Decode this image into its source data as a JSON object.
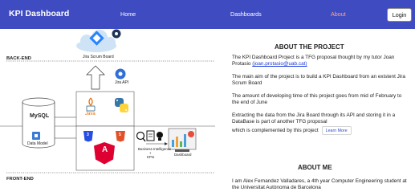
{
  "navbar": {
    "brand": "KPI Dashboard",
    "links": [
      {
        "label": "Home",
        "active": false
      },
      {
        "label": "Dashboards",
        "active": false
      },
      {
        "label": "About",
        "active": true
      }
    ],
    "login_label": "Login"
  },
  "colors": {
    "navbar_bg": "#3f4bc0",
    "active_link": "#f7a98a",
    "link_blue": "#1a3bd8"
  },
  "diagram": {
    "backend_label": "BACK-END",
    "frontend_label": "FRONT-END",
    "jira_board_label": "Jira Scrum Board",
    "jira_api_label": "Jira API",
    "data_model_label": "Data Model",
    "bi_label_line1": "Business Intelligence",
    "bi_label_line2": "+",
    "bi_label_line3": "KPIs",
    "dashboard_label": "Dashboard",
    "mysql_label": "MySQL",
    "java_label": "Java",
    "angular_letter": "A",
    "css_badge": "3",
    "html_badge": "5"
  },
  "about_project": {
    "title": "ABOUT THE PROJECT",
    "p1_text": "The KPI Dashboard Project is a TFG proposal thought by my tutor Joan Protasio ",
    "p1_link": "(joan.protasio@uab.cat)",
    "p2": "The main aim of the project is to build a KPI Dashboard from an existent Jira Scrum Board",
    "p3": "The amount of developing time of this project goes from mid of February to the end of June",
    "p4_line1": "Extracting the data from the Jira Board through its API and storing it in a DataBase is part of another TFG proposal",
    "p4_line2": "which is complemented by this project",
    "learn_more": "Learn More"
  },
  "about_me": {
    "title": "ABOUT ME",
    "p1": "I am Alex Fernandez Valladares, a 4th year Computer Engineering student at the Universitat Autònoma de Barcelona"
  }
}
